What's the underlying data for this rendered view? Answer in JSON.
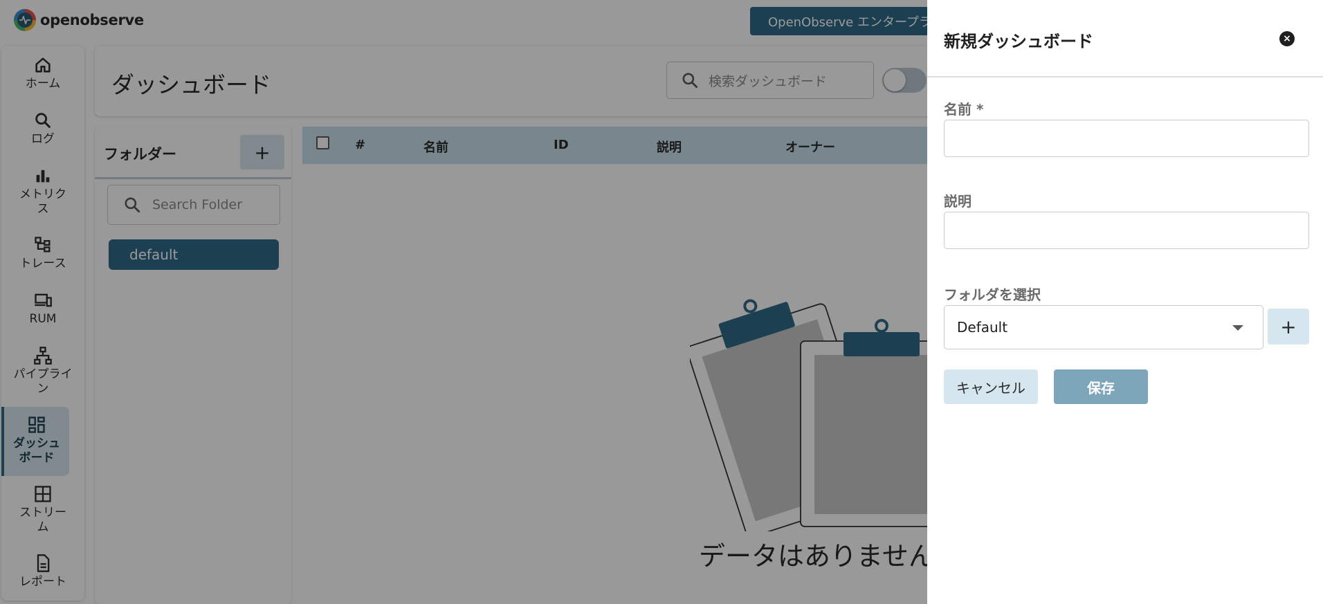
{
  "app": {
    "logo_text": "openobserve",
    "enterprise_button": "OpenObserve エンタープライズ"
  },
  "nav": {
    "items": [
      {
        "label": "ホーム",
        "icon": "home-icon"
      },
      {
        "label": "ログ",
        "icon": "search-icon"
      },
      {
        "label": "メトリクス",
        "icon": "bar-chart-icon"
      },
      {
        "label": "トレース",
        "icon": "trace-tree-icon"
      },
      {
        "label": "RUM",
        "icon": "devices-icon"
      },
      {
        "label": "パイプライン",
        "icon": "pipeline-icon"
      },
      {
        "label": "ダッシュボード",
        "icon": "dashboard-grid-icon",
        "active": true
      },
      {
        "label": "ストリーム",
        "icon": "stream-grid-icon"
      },
      {
        "label": "レポート",
        "icon": "report-doc-icon"
      }
    ]
  },
  "header": {
    "title": "ダッシュボード",
    "search_placeholder": "検索ダッシュボード"
  },
  "folders": {
    "title": "フォルダー",
    "add_label": "+",
    "search_placeholder": "Search Folder",
    "items": [
      "default"
    ]
  },
  "table": {
    "columns": [
      "#",
      "名前",
      "ID",
      "説明",
      "オーナー"
    ],
    "empty_text": "データはありません"
  },
  "drawer": {
    "title": "新規ダッシュボード",
    "close_label": "×",
    "name_label": "名前 *",
    "name_value": "",
    "description_label": "説明",
    "description_value": "",
    "folder_label": "フォルダを選択",
    "folder_selected": "Default",
    "folder_add_label": "+",
    "cancel_label": "キャンセル",
    "save_label": "保存"
  },
  "colors": {
    "primary": "#2f6b87",
    "accent_light": "#d6e6ee",
    "table_header": "#c9e0ec",
    "save_disabled": "#7ea6bb"
  }
}
